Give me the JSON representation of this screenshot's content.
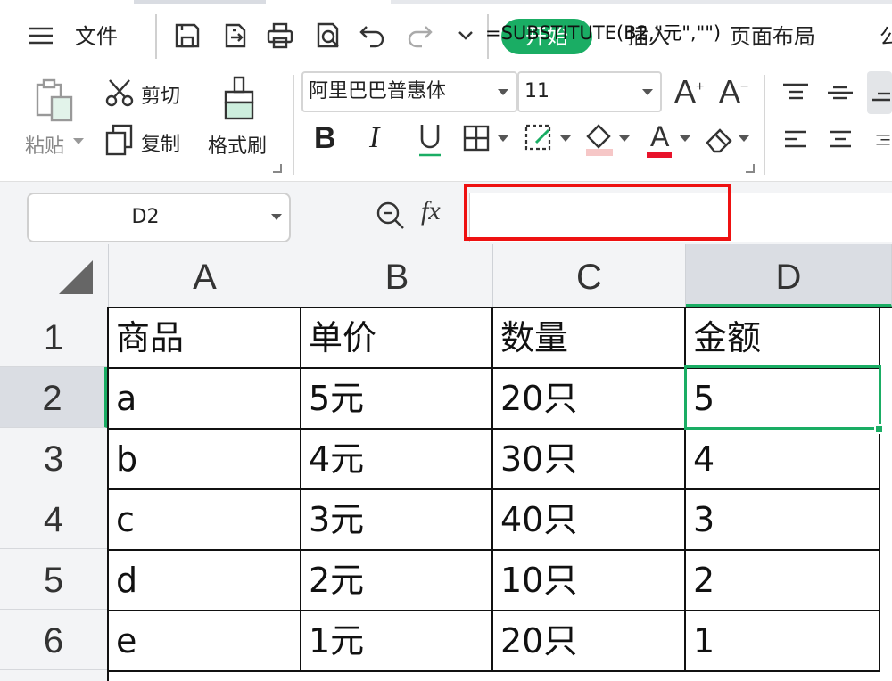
{
  "menubar": {
    "menu_icon": "hamburger-icon",
    "file_label": "文件",
    "tabs": [
      {
        "label": "开始",
        "active": true
      },
      {
        "label": "插入",
        "active": false
      },
      {
        "label": "页面布局",
        "active": false
      },
      {
        "label": "公",
        "active": false
      }
    ],
    "quick_icons": [
      "save-icon",
      "export-icon",
      "print-icon",
      "print-preview-icon",
      "undo-icon",
      "redo-icon",
      "customize-dropdown-icon"
    ]
  },
  "ribbon": {
    "paste_label": "粘贴",
    "cut_label": "剪切",
    "copy_label": "复制",
    "format_painter_label": "格式刷",
    "font_name": "阿里巴巴普惠体",
    "font_size": "11",
    "grow_font": "A",
    "shrink_font": "A",
    "bold": "B",
    "italic": "I",
    "underline": "U",
    "font_color_glyph": "A",
    "colors": {
      "accent": "#1aad64",
      "font_color": "#e8132b",
      "fill_color": "#f6c7c7",
      "highlight_box": "#ee1111"
    }
  },
  "formula": {
    "name_box": "D2",
    "fx_label": "fx",
    "formula_text": "=SUBSTITUTE(B2,\"元\",\"\")"
  },
  "grid": {
    "columns": [
      "A",
      "B",
      "C",
      "D"
    ],
    "active_column": "D",
    "active_row": "2",
    "row_numbers": [
      "1",
      "2",
      "3",
      "4",
      "5",
      "6"
    ],
    "rows": [
      [
        "商品",
        "单价",
        "数量",
        "金额"
      ],
      [
        "a",
        "5元",
        "20只",
        "5"
      ],
      [
        "b",
        "4元",
        "30只",
        "4"
      ],
      [
        "c",
        "3元",
        "40只",
        "3"
      ],
      [
        "d",
        "2元",
        "10只",
        "2"
      ],
      [
        "e",
        "1元",
        "20只",
        "1"
      ]
    ]
  }
}
